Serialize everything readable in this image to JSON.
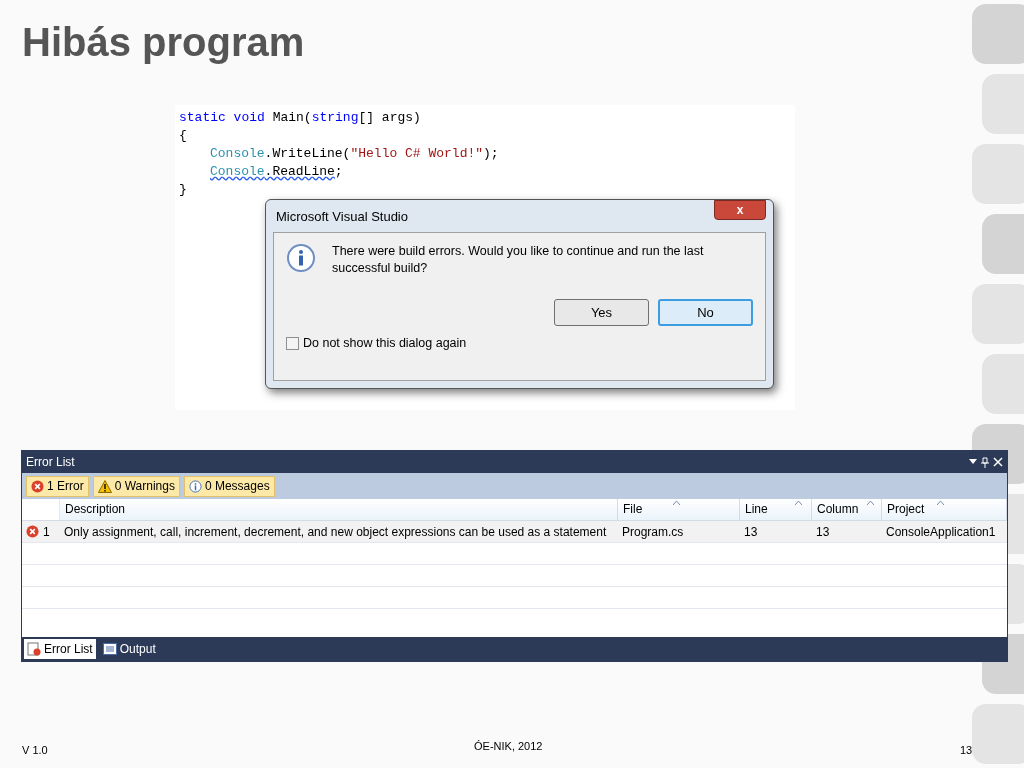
{
  "title": "Hibás program",
  "code": {
    "lines": [
      {
        "indented": false,
        "segments": [
          {
            "text": "static ",
            "kind": "keyword"
          },
          {
            "text": "void",
            "kind": "keyword"
          },
          {
            "text": " Main(",
            "kind": "plain"
          },
          {
            "text": "string",
            "kind": "keyword"
          },
          {
            "text": "[] args)",
            "kind": "plain"
          }
        ]
      },
      {
        "indented": false,
        "segments": [
          {
            "text": "{",
            "kind": "plain"
          }
        ]
      },
      {
        "indented": true,
        "segments": [
          {
            "text": "Console",
            "kind": "type"
          },
          {
            "text": ".WriteLine(",
            "kind": "plain"
          },
          {
            "text": "\"Hello C# World!\"",
            "kind": "string"
          },
          {
            "text": ");",
            "kind": "plain"
          }
        ]
      },
      {
        "indented": true,
        "segments": [
          {
            "text": "Console",
            "kind": "type",
            "error": true
          },
          {
            "text": ".ReadLine",
            "kind": "plain",
            "error": true
          },
          {
            "text": ";",
            "kind": "plain"
          }
        ]
      },
      {
        "indented": false,
        "segments": [
          {
            "text": "}",
            "kind": "plain"
          }
        ]
      }
    ]
  },
  "dialog": {
    "title": "Microsoft Visual Studio",
    "close": "x",
    "message": "There were build errors. Would you like to continue and run the last successful build?",
    "buttons": [
      {
        "label": "Yes",
        "selected": false
      },
      {
        "label": "No",
        "selected": true
      }
    ],
    "checkbox": {
      "label": "Do not show this dialog again",
      "checked": false
    }
  },
  "error_list": {
    "title": "Error List",
    "filters": [
      {
        "label": "1 Error",
        "kind": "error"
      },
      {
        "label": "0 Warnings",
        "kind": "warning"
      },
      {
        "label": "0 Messages",
        "kind": "info"
      }
    ],
    "columns": [
      {
        "label": "Description",
        "sortable": false
      },
      {
        "label": "File",
        "sortable": true
      },
      {
        "label": "Line",
        "sortable": true
      },
      {
        "label": "Column",
        "sortable": true
      },
      {
        "label": "Project",
        "sortable": true
      }
    ],
    "rows": [
      {
        "number": "1",
        "description": "Only assignment, call, increment, decrement, and new object expressions can be used as a statement",
        "file": "Program.cs",
        "line": "13",
        "column": "13",
        "project": "ConsoleApplication1"
      }
    ],
    "tabs": [
      {
        "label": "Error List",
        "kind": "errors",
        "selected": true
      },
      {
        "label": "Output",
        "kind": "output",
        "selected": false
      }
    ]
  },
  "footer": {
    "version": "V 1.0",
    "center": "ÓE-NIK, 2012",
    "page": "13"
  }
}
